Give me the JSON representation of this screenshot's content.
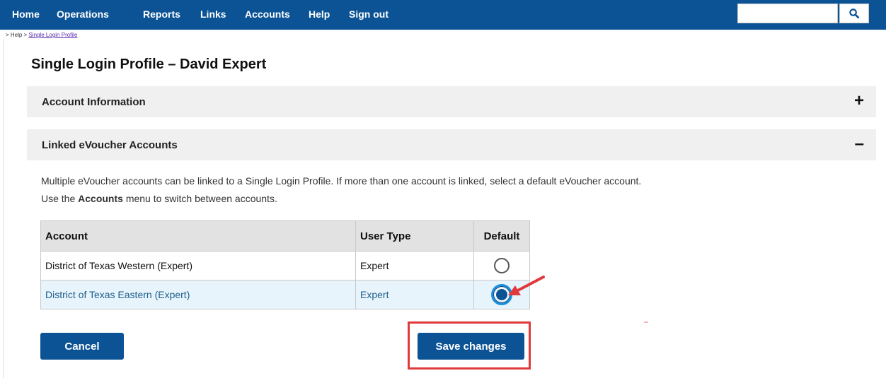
{
  "nav": {
    "items": [
      "Home",
      "Operations",
      "Reports",
      "Links",
      "Accounts",
      "Help",
      "Sign out"
    ],
    "search_placeholder": "",
    "search_icon": "search-icon"
  },
  "breadcrumb": {
    "prefix": "> Help > ",
    "current": "Single Login Profile"
  },
  "page": {
    "title": "Single Login Profile – David Expert"
  },
  "panels": [
    {
      "label": "Account Information",
      "toggle": "+",
      "state": "collapsed"
    },
    {
      "label": "Linked eVoucher Accounts",
      "toggle": "–",
      "state": "expanded"
    }
  ],
  "linked": {
    "desc_line1": "Multiple eVoucher accounts can be linked to a Single Login Profile. If more than one account is linked, select a default eVoucher account.",
    "desc_line2_pre": "Use the ",
    "desc_line2_bold": "Accounts",
    "desc_line2_post": " menu to switch between accounts.",
    "table": {
      "headers": [
        "Account",
        "User Type",
        "Default"
      ],
      "rows": [
        {
          "account": "District of Texas Western (Expert)",
          "user_type": "Expert",
          "default": false
        },
        {
          "account": "District of Texas Eastern (Expert)",
          "user_type": "Expert",
          "default": true
        }
      ]
    }
  },
  "actions": {
    "cancel": "Cancel",
    "save": "Save changes"
  },
  "colors": {
    "brand": "#0b5395",
    "panel_bg": "#f0f0f0",
    "selected_row": "#e8f4fb",
    "annotation_red": "#e0393c"
  }
}
